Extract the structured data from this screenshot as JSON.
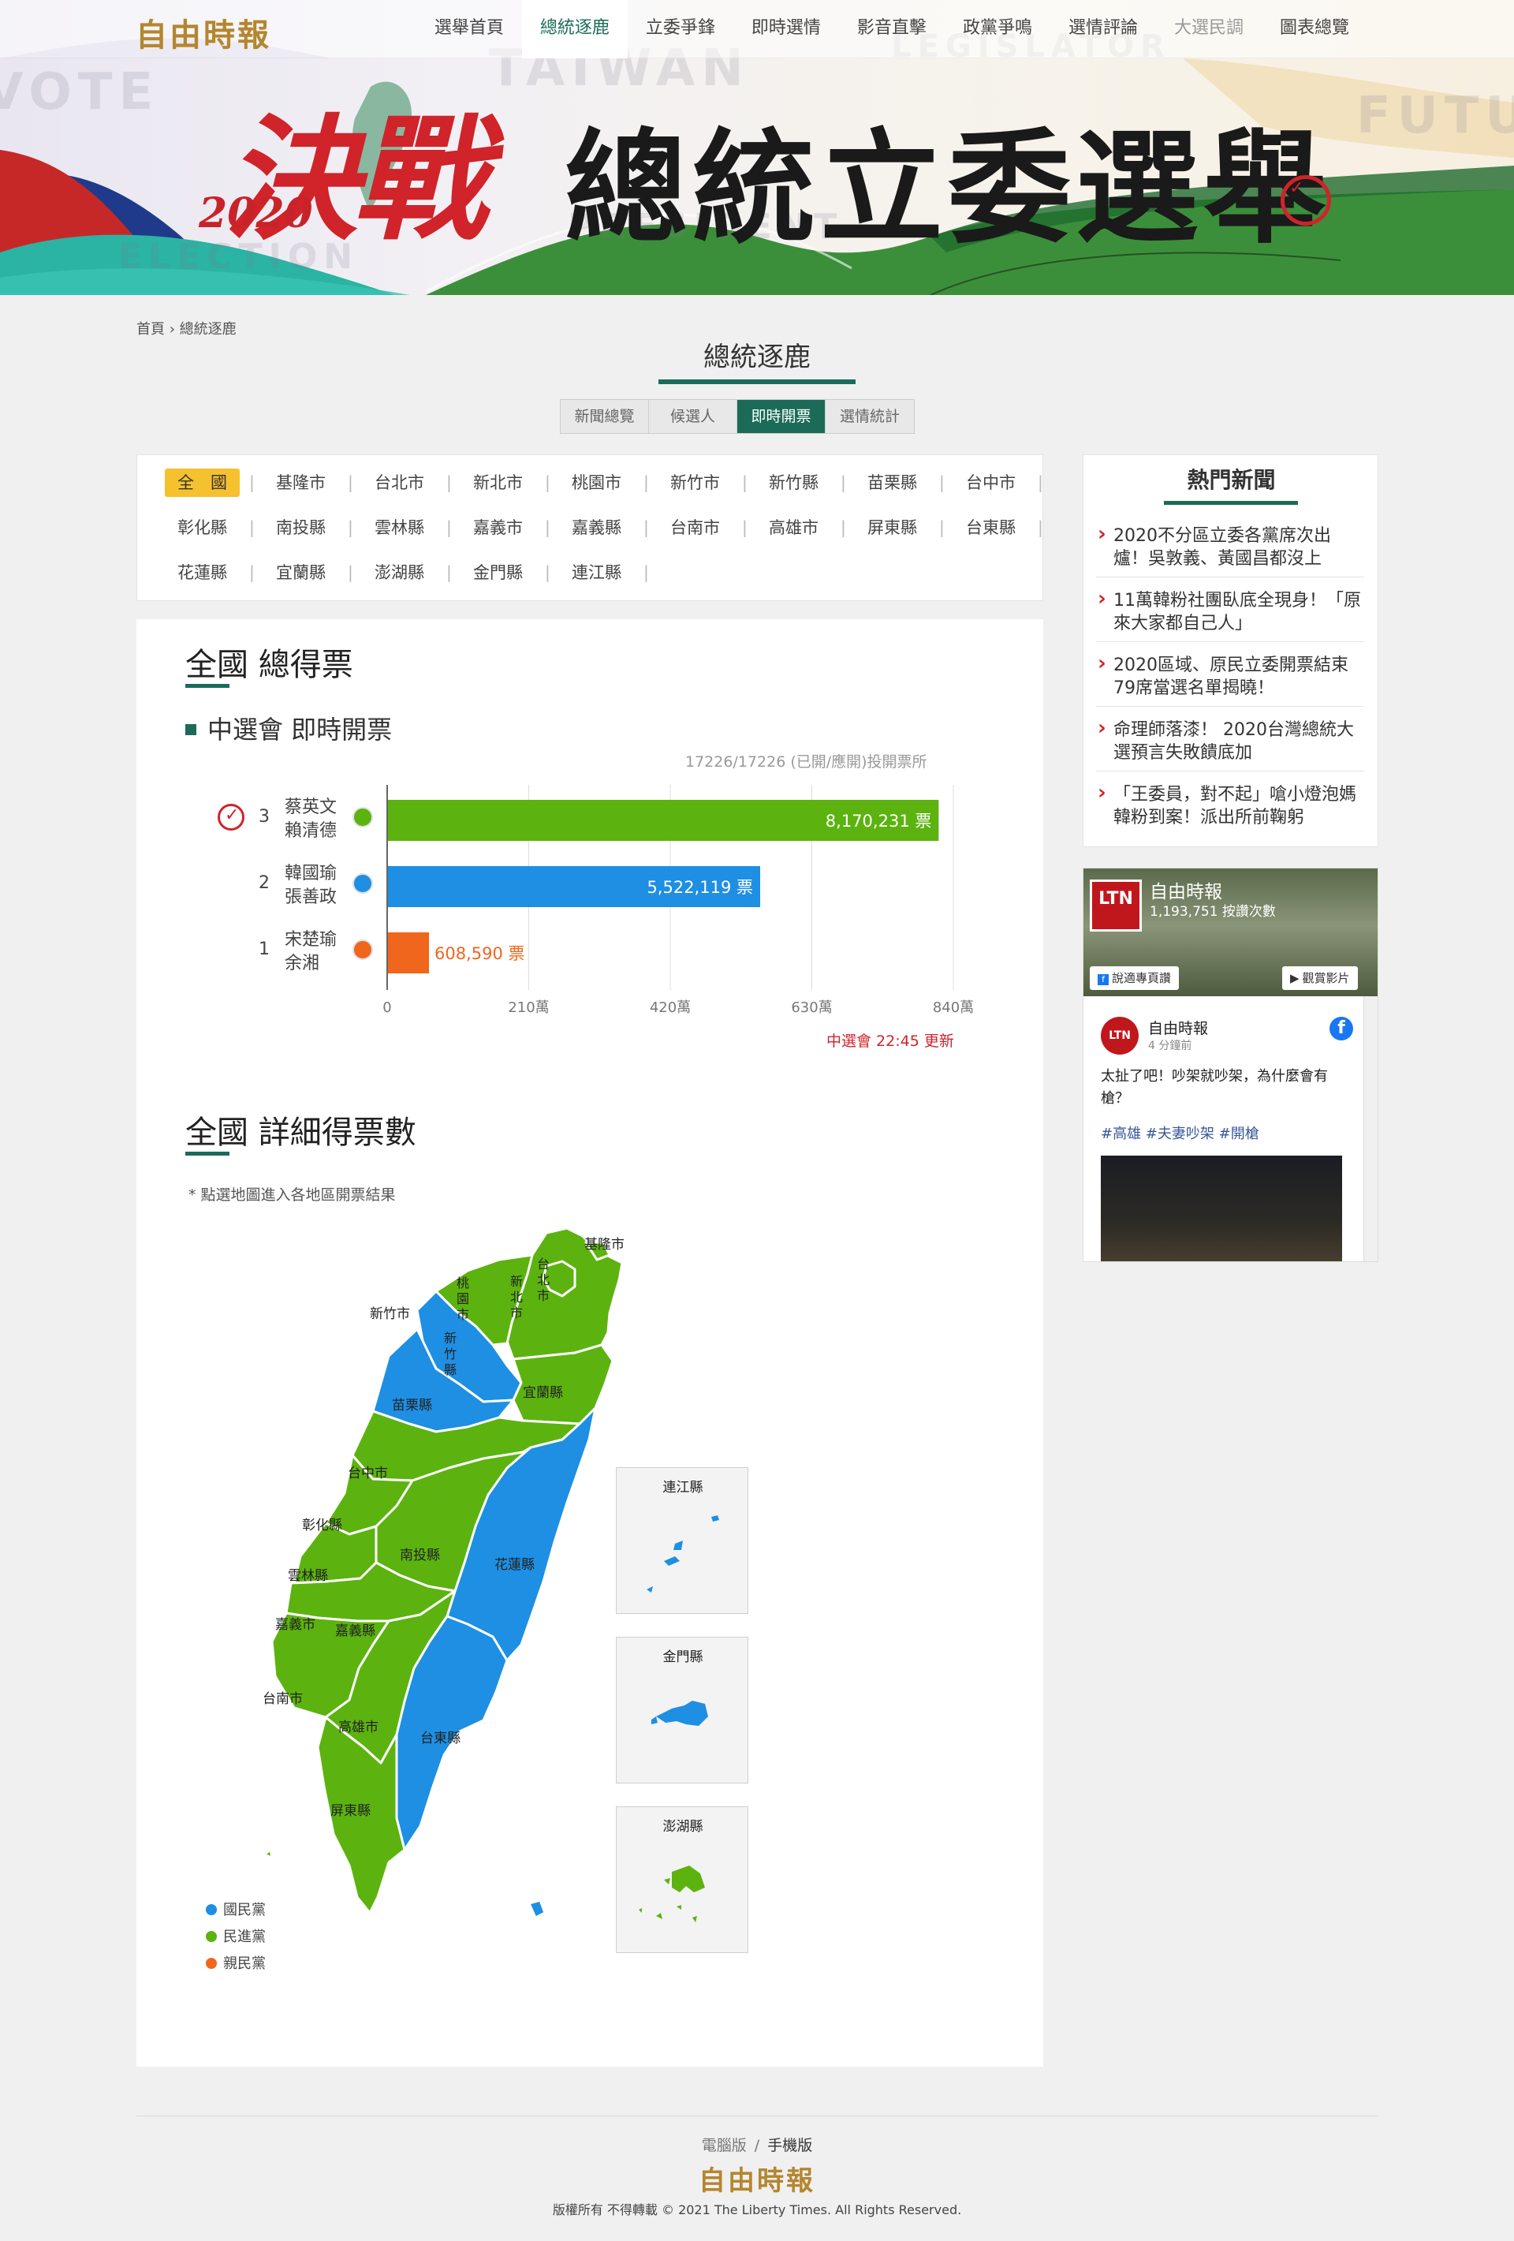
{
  "site": {
    "logo": "自由時報"
  },
  "nav": [
    {
      "label": "選舉首頁",
      "active": false,
      "muted": false
    },
    {
      "label": "總統逐鹿",
      "active": true,
      "muted": false
    },
    {
      "label": "立委爭鋒",
      "active": false,
      "muted": false
    },
    {
      "label": "即時選情",
      "active": false,
      "muted": false
    },
    {
      "label": "影音直擊",
      "active": false,
      "muted": false
    },
    {
      "label": "政黨爭鳴",
      "active": false,
      "muted": false
    },
    {
      "label": "選情評論",
      "active": false,
      "muted": false
    },
    {
      "label": "大選民調",
      "active": false,
      "muted": true
    },
    {
      "label": "圖表總覽",
      "active": false,
      "muted": false
    }
  ],
  "hero": {
    "decide": "決戰",
    "year": "2020",
    "title": "總統立委選舉",
    "bg_words": [
      "VOTE",
      "TAIWAN",
      "LEGISLATOR",
      "FUTU",
      "PRESIDENT",
      "ELECTION"
    ]
  },
  "breadcrumb": {
    "home": "首頁",
    "sep": "›",
    "current": "總統逐鹿"
  },
  "section_title": "總統逐鹿",
  "subtabs": [
    {
      "label": "新聞總覽",
      "active": false
    },
    {
      "label": "候選人",
      "active": false
    },
    {
      "label": "即時開票",
      "active": true
    },
    {
      "label": "選情統計",
      "active": false
    }
  ],
  "regions": [
    [
      "全　國",
      "基隆市",
      "台北市",
      "新北市",
      "桃園市",
      "新竹市",
      "新竹縣",
      "苗栗縣",
      "台中市"
    ],
    [
      "彰化縣",
      "南投縣",
      "雲林縣",
      "嘉義市",
      "嘉義縣",
      "台南市",
      "高雄市",
      "屏東縣",
      "台東縣"
    ],
    [
      "花蓮縣",
      "宜蘭縣",
      "澎湖縣",
      "金門縣",
      "連江縣"
    ]
  ],
  "votes_section": {
    "heading": "全國 總得票",
    "subheading": "中選會 即時開票",
    "progress": "17226/17226 (已開/應開)投開票所",
    "update": "中選會 22:45 更新"
  },
  "chart_data": {
    "type": "bar",
    "orientation": "horizontal",
    "categories": [
      "蔡英文 賴清德",
      "韓國瑜 張善政",
      "宋楚瑜 余湘"
    ],
    "numbers": [
      "3",
      "2",
      "1"
    ],
    "values": [
      8170231,
      5522119,
      608590
    ],
    "value_labels": [
      "8,170,231 票",
      "5,522,119 票",
      "608,590 票"
    ],
    "colors": [
      "#5cb30f",
      "#1e8fe3",
      "#f0661d"
    ],
    "xlim": [
      0,
      8400000
    ],
    "x_ticks": [
      0,
      2100000,
      4200000,
      6300000,
      8400000
    ],
    "x_tick_labels": [
      "0",
      "210萬",
      "420萬",
      "630萬",
      "840萬"
    ],
    "grid": true
  },
  "candidates": [
    {
      "num": "3",
      "pres": "蔡英文",
      "vice": "賴清德",
      "party_icon": "dpp-icon",
      "winner": true
    },
    {
      "num": "2",
      "pres": "韓國瑜",
      "vice": "張善政",
      "party_icon": "kmt-icon",
      "winner": false
    },
    {
      "num": "1",
      "pres": "宋楚瑜",
      "vice": "余湘",
      "party_icon": "pfp-icon",
      "winner": false
    }
  ],
  "detail_section": {
    "heading": "全國 詳細得票數",
    "footnote": "* 點選地圖進入各地區開票結果"
  },
  "map": {
    "labels": [
      "基隆市",
      "台北市",
      "新北市",
      "桃園市",
      "新竹市",
      "新竹縣",
      "苗栗縣",
      "宜蘭縣",
      "台中市",
      "彰化縣",
      "南投縣",
      "花蓮縣",
      "雲林縣",
      "嘉義市",
      "嘉義縣",
      "台南市",
      "高雄市",
      "台東縣",
      "屏東縣"
    ],
    "insets": [
      "連江縣",
      "金門縣",
      "澎湖縣"
    ],
    "colors": {
      "kmt": "#1e8fe3",
      "dpp": "#5cb30f",
      "pfp": "#f0661d"
    },
    "legend": [
      {
        "label": "國民黨",
        "color": "#1e8fe3"
      },
      {
        "label": "民進黨",
        "color": "#5cb30f"
      },
      {
        "label": "親民黨",
        "color": "#f0661d"
      }
    ]
  },
  "sidebar": {
    "title": "熱門新聞",
    "news": [
      "2020不分區立委各黨席次出爐！吳敦義、黃國昌都沒上",
      "11萬韓粉社團臥底全現身！「原來大家都自己人」",
      "2020區域、原民立委開票結束 79席當選名單揭曉！",
      "命理師落漆！ 2020台灣總統大選預言失敗饋底加",
      "「王委員，對不起」嗆小燈泡媽韓粉到案！派出所前鞠躬"
    ]
  },
  "facebook": {
    "page_name": "自由時報",
    "fans": "1,193,751 按讚次數",
    "btn_subscribe": "說適專頁讚",
    "btn_video": "觀賞影片",
    "logo_text": "LTN",
    "post_page": "自由時報",
    "post_time": "4 分鐘前",
    "post_text": "太扯了吧！吵架就吵架，為什麼會有槍？",
    "post_tags": "#高雄 #夫妻吵架 #開槍"
  },
  "footer": {
    "desktop": "電腦版",
    "sep": "/",
    "mobile": "手機版",
    "logo": "自由時報",
    "copyright": "版權所有 不得轉載 © 2021 The Liberty Times. All Rights Reserved."
  }
}
